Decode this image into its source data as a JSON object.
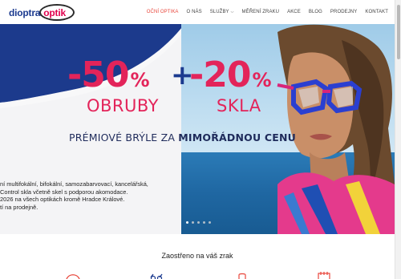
{
  "header": {
    "logo_word1": "dioptra",
    "logo_word2": "optik",
    "nav": [
      {
        "label": "OČNÍ OPTIKA",
        "active": true
      },
      {
        "label": "O NÁS"
      },
      {
        "label": "SLUŽBY"
      },
      {
        "label": "MĚŘENÍ ZRAKU"
      },
      {
        "label": "AKCE"
      },
      {
        "label": "BLOG"
      },
      {
        "label": "PRODEJNY"
      },
      {
        "label": "KONTAKT"
      }
    ]
  },
  "hero": {
    "discount_frames": "-50",
    "discount_frames_pct": "%",
    "plus": "+",
    "discount_lenses": "-20",
    "discount_lenses_pct": "%",
    "label_frames": "OBRUBY",
    "label_lenses": "SKLA",
    "tagline_normal": "PRÉMIOVÉ BRÝLE ZA ",
    "tagline_bold": "MIMOŘÁDNOU CENU",
    "desc_lines": [
      "ní multifokální, bifokální, samozabarvovací, kancelářská,",
      " Control skla včetně skel s podporou akomodace.",
      "2026 na všech optikách kromě Hradce Králové.",
      "tí na prodejně."
    ],
    "slide_count": 5,
    "active_slide": 1
  },
  "section": {
    "title": "Zaostřeno na váš zrak"
  },
  "colors": {
    "accent_pink": "#e3245a",
    "brand_blue": "#1b3a8f",
    "nav_active": "#e8473c"
  },
  "icons": [
    "caret-down-icon",
    "eye-icon",
    "glasses-icon",
    "lens-icon",
    "calendar-icon"
  ]
}
